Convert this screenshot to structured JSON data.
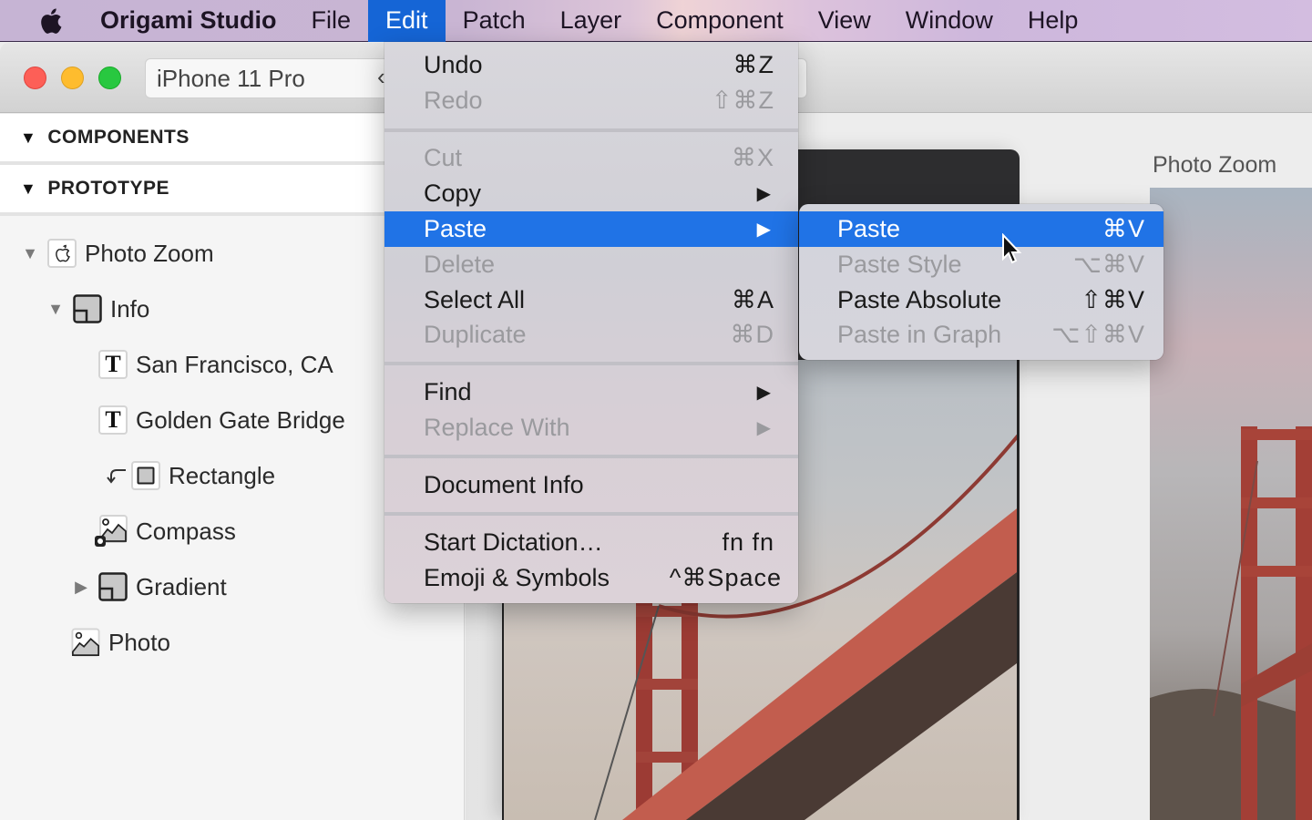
{
  "menubar": {
    "apple_icon": "apple-logo-icon",
    "app_name": "Origami Studio",
    "items": [
      "File",
      "Edit",
      "Patch",
      "Layer",
      "Component",
      "View",
      "Window",
      "Help"
    ],
    "active": "Edit"
  },
  "toolbar": {
    "device": "iPhone 11 Pro",
    "device_chevron": "‹",
    "traffic_lights": [
      "close",
      "minimize",
      "zoom"
    ]
  },
  "sidebar": {
    "sections": [
      {
        "label": "COMPONENTS",
        "expanded": true
      },
      {
        "label": "PROTOTYPE",
        "expanded": true
      }
    ],
    "tree": [
      {
        "label": "Photo Zoom",
        "icon": "app-icon",
        "disclosure": "expanded",
        "depth": 0
      },
      {
        "label": "Info",
        "icon": "group-icon",
        "disclosure": "expanded",
        "depth": 1
      },
      {
        "label": "San Francisco, CA",
        "icon": "text-layer-icon",
        "disclosure": "none",
        "depth": 2
      },
      {
        "label": "Golden Gate Bridge",
        "icon": "text-layer-icon",
        "disclosure": "none",
        "depth": 2
      },
      {
        "label": "Rectangle",
        "icon": "rectangle-icon",
        "disclosure": "none",
        "depth": 2,
        "mask": true
      },
      {
        "label": "Compass",
        "icon": "image-icon",
        "disclosure": "none",
        "depth": 1,
        "component_badge": true
      },
      {
        "label": "Gradient",
        "icon": "group-icon",
        "disclosure": "collapsed",
        "depth": 1
      },
      {
        "label": "Photo",
        "icon": "image-icon",
        "disclosure": "none",
        "depth": 0
      }
    ]
  },
  "canvas": {
    "preview_tools": [
      "rotate-icon",
      "record-icon",
      "gear-icon",
      "chevron-down-icon"
    ],
    "right_label": "Photo Zoom"
  },
  "edit_menu": {
    "groups": [
      [
        {
          "label": "Undo",
          "shortcut": "⌘Z",
          "enabled": true
        },
        {
          "label": "Redo",
          "shortcut": "⇧⌘Z",
          "enabled": false
        }
      ],
      [
        {
          "label": "Cut",
          "shortcut": "⌘X",
          "enabled": false
        },
        {
          "label": "Copy",
          "shortcut": "",
          "submenu": true,
          "enabled": true
        },
        {
          "label": "Paste",
          "shortcut": "",
          "submenu": true,
          "enabled": true,
          "highlighted": true
        },
        {
          "label": "Delete",
          "shortcut": "",
          "enabled": false
        },
        {
          "label": "Select All",
          "shortcut": "⌘A",
          "enabled": true
        },
        {
          "label": "Duplicate",
          "shortcut": "⌘D",
          "enabled": false
        }
      ],
      [
        {
          "label": "Find",
          "shortcut": "",
          "submenu": true,
          "enabled": true
        },
        {
          "label": "Replace With",
          "shortcut": "",
          "submenu": true,
          "enabled": false
        }
      ],
      [
        {
          "label": "Document Info",
          "shortcut": "",
          "enabled": true
        }
      ],
      [
        {
          "label": "Start Dictation…",
          "shortcut": "fn fn",
          "enabled": true
        },
        {
          "label": "Emoji & Symbols",
          "shortcut": "^⌘Space",
          "enabled": true
        }
      ]
    ]
  },
  "paste_submenu": {
    "items": [
      {
        "label": "Paste",
        "shortcut": "⌘V",
        "enabled": true,
        "highlighted": true
      },
      {
        "label": "Paste Style",
        "shortcut": "⌥⌘V",
        "enabled": false
      },
      {
        "label": "Paste Absolute",
        "shortcut": "⇧⌘V",
        "enabled": true
      },
      {
        "label": "Paste in Graph",
        "shortcut": "⌥⇧⌘V",
        "enabled": false
      }
    ]
  },
  "colors": {
    "menu_highlight": "#2073e6",
    "menubar_active": "#1565d6",
    "disabled_text": "#9a9a9e",
    "close": "#fd5f57",
    "minimize": "#febc2e",
    "zoom": "#28c840"
  }
}
